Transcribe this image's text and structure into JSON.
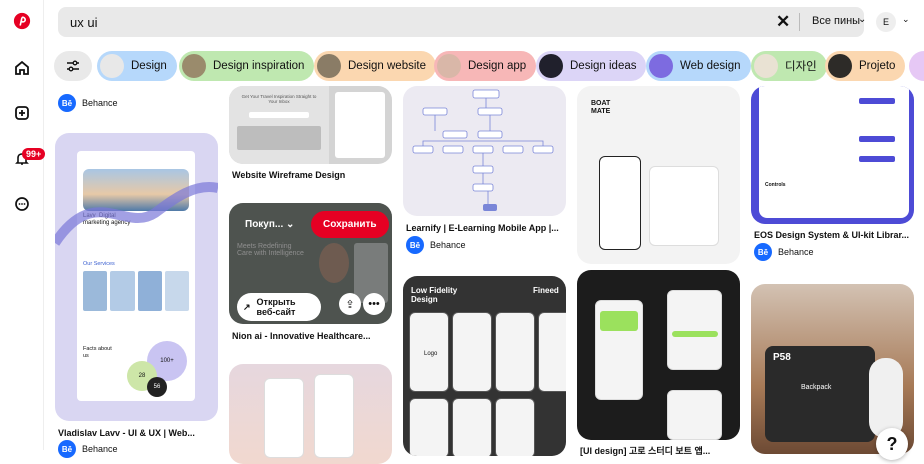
{
  "search": {
    "query": "ux ui",
    "filter_label": "Все пины"
  },
  "user": {
    "initial": "E"
  },
  "notifications": {
    "badge": "99+"
  },
  "chips": [
    {
      "label": "Design",
      "color": "#b6d8fb",
      "thumb": "#e8e8e8"
    },
    {
      "label": "Design inspiration",
      "color": "#bfe8b0",
      "thumb": "#9a8b6c"
    },
    {
      "label": "Design website",
      "color": "#fbd7b0",
      "thumb": "#8a7c66"
    },
    {
      "label": "Design app",
      "color": "#f7b7b7",
      "thumb": "#d9b7a8"
    },
    {
      "label": "Design ideas",
      "color": "#dcd5f7",
      "thumb": "#20202c"
    },
    {
      "label": "Web design",
      "color": "#b6d8fb",
      "thumb": "#7d6be0"
    },
    {
      "label": "디자인",
      "color": "#bfe8b0",
      "thumb": "#e9e2d3"
    },
    {
      "label": "Projeto",
      "color": "#fbd7b0",
      "thumb": "#2d2b28"
    }
  ],
  "pins": {
    "c1_top_source": "Behance",
    "lavv": {
      "title": "Vladislav Lavv - UI & UX | Web...",
      "source": "Behance",
      "hero_line1": "Lavv",
      "hero_line2": "Digital",
      "hero_line3": "marketing agency",
      "services": "Our Services",
      "facts": "Facts about us",
      "n1": "100+",
      "n2": "28",
      "n3": "56"
    },
    "wireframe": {
      "title": "Website Wireframe Design",
      "heading": "Get Your Travel Inspiration Straight to Your Inbox"
    },
    "nion": {
      "title": "Nion ai - Innovative Healthcare...",
      "dropdown": "Покуп...",
      "save": "Сохранить",
      "open": "Открыть веб-сайт",
      "headline": "Meets Redefining Care with Intelligence"
    },
    "learnify": {
      "title": "Learnify | E-Learning Mobile App |...",
      "source": "Behance"
    },
    "lowfi": {
      "heading": "Low  Fidelity Design",
      "brand": "Fineed",
      "logo": "Logo"
    },
    "boatmate": {
      "logo": "BOAT MATE",
      "title": "[UI design] 고로 스터디 보트 앱..."
    },
    "eos": {
      "title": "EOS Design System & UI-kit Librar...",
      "source": "Behance",
      "controls": "Controls"
    },
    "p58": {
      "title": "P58",
      "sub": "Backpack"
    }
  },
  "colors": {
    "brand": "#e60023",
    "behance": "#1769ff"
  }
}
